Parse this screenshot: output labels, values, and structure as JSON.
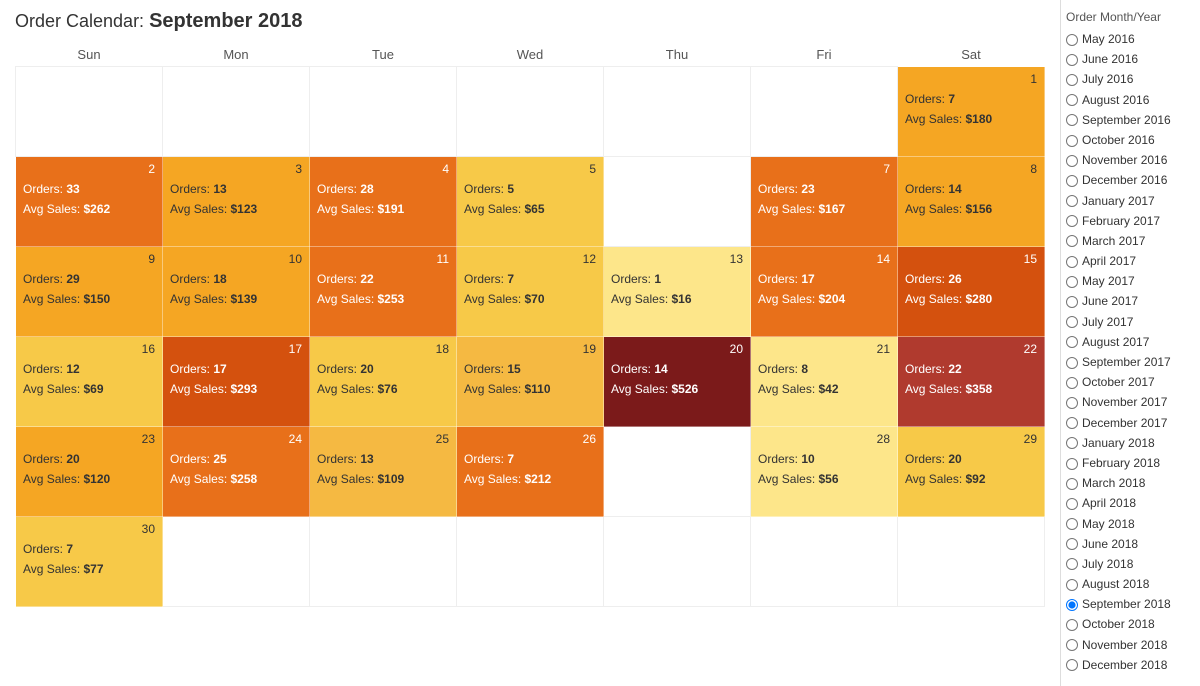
{
  "header": {
    "title_prefix": "Order Calendar:",
    "title_bold": "September 2018"
  },
  "calendar": {
    "headers": [
      "Sun",
      "Mon",
      "Tue",
      "Wed",
      "Thu",
      "Fri",
      "Sat"
    ],
    "rows": [
      [
        {
          "day": "",
          "empty": true
        },
        {
          "day": "",
          "empty": true
        },
        {
          "day": "",
          "empty": true
        },
        {
          "day": "",
          "empty": true
        },
        {
          "day": "",
          "empty": true
        },
        {
          "day": "",
          "empty": true
        },
        {
          "day": "1",
          "orders": 7,
          "avg_sales": 180,
          "color": "light-orange"
        }
      ],
      [
        {
          "day": "2",
          "orders": 33,
          "avg_sales": 262,
          "color": "orange"
        },
        {
          "day": "3",
          "orders": 13,
          "avg_sales": 123,
          "color": "light-orange"
        },
        {
          "day": "4",
          "orders": 28,
          "avg_sales": 191,
          "color": "orange"
        },
        {
          "day": "5",
          "orders": 5,
          "avg_sales": 65,
          "color": "yellow"
        },
        {
          "day": "",
          "empty": true
        },
        {
          "day": "7",
          "orders": 23,
          "avg_sales": 167,
          "color": "orange"
        },
        {
          "day": "8",
          "orders": 14,
          "avg_sales": 156,
          "color": "light-orange"
        }
      ],
      [
        {
          "day": "9",
          "orders": 29,
          "avg_sales": 150,
          "color": "light-orange"
        },
        {
          "day": "10",
          "orders": 18,
          "avg_sales": 139,
          "color": "light-orange"
        },
        {
          "day": "11",
          "orders": 22,
          "avg_sales": 253,
          "color": "orange"
        },
        {
          "day": "12",
          "orders": 7,
          "avg_sales": 70,
          "color": "yellow"
        },
        {
          "day": "13",
          "orders": 1,
          "avg_sales": 16,
          "color": "very-light"
        },
        {
          "day": "14",
          "orders": 17,
          "avg_sales": 204,
          "color": "orange"
        },
        {
          "day": "15",
          "orders": 26,
          "avg_sales": 280,
          "color": "dark-orange"
        }
      ],
      [
        {
          "day": "16",
          "orders": 12,
          "avg_sales": 69,
          "color": "yellow"
        },
        {
          "day": "17",
          "orders": 17,
          "avg_sales": 293,
          "color": "dark-orange"
        },
        {
          "day": "18",
          "orders": 20,
          "avg_sales": 76,
          "color": "yellow"
        },
        {
          "day": "19",
          "orders": 15,
          "avg_sales": 110,
          "color": "pale-orange"
        },
        {
          "day": "20",
          "orders": 14,
          "avg_sales": 526,
          "color": "dark-red"
        },
        {
          "day": "21",
          "orders": 8,
          "avg_sales": 42,
          "color": "very-light"
        },
        {
          "day": "22",
          "orders": 22,
          "avg_sales": 358,
          "color": "red"
        }
      ],
      [
        {
          "day": "23",
          "orders": 20,
          "avg_sales": 120,
          "color": "light-orange"
        },
        {
          "day": "24",
          "orders": 25,
          "avg_sales": 258,
          "color": "orange"
        },
        {
          "day": "25",
          "orders": 13,
          "avg_sales": 109,
          "color": "pale-orange"
        },
        {
          "day": "26",
          "orders": 7,
          "avg_sales": 212,
          "color": "orange"
        },
        {
          "day": "",
          "empty": true
        },
        {
          "day": "28",
          "orders": 10,
          "avg_sales": 56,
          "color": "very-light"
        },
        {
          "day": "29",
          "orders": 20,
          "avg_sales": 92,
          "color": "yellow"
        }
      ],
      [
        {
          "day": "30",
          "orders": 7,
          "avg_sales": 77,
          "color": "yellow"
        },
        {
          "day": "",
          "empty": true
        },
        {
          "day": "",
          "empty": true
        },
        {
          "day": "",
          "empty": true
        },
        {
          "day": "",
          "empty": true
        },
        {
          "day": "",
          "empty": true
        },
        {
          "day": "",
          "empty": true
        }
      ]
    ]
  },
  "sidebar": {
    "title": "Order Month/Year",
    "options": [
      {
        "label": "May 2016",
        "value": "may2016",
        "selected": false
      },
      {
        "label": "June 2016",
        "value": "jun2016",
        "selected": false
      },
      {
        "label": "July 2016",
        "value": "jul2016",
        "selected": false
      },
      {
        "label": "August 2016",
        "value": "aug2016",
        "selected": false
      },
      {
        "label": "September 2016",
        "value": "sep2016",
        "selected": false
      },
      {
        "label": "October 2016",
        "value": "oct2016",
        "selected": false
      },
      {
        "label": "November 2016",
        "value": "nov2016",
        "selected": false
      },
      {
        "label": "December 2016",
        "value": "dec2016",
        "selected": false
      },
      {
        "label": "January 2017",
        "value": "jan2017",
        "selected": false
      },
      {
        "label": "February 2017",
        "value": "feb2017",
        "selected": false
      },
      {
        "label": "March 2017",
        "value": "mar2017",
        "selected": false
      },
      {
        "label": "April 2017",
        "value": "apr2017",
        "selected": false
      },
      {
        "label": "May 2017",
        "value": "may2017",
        "selected": false
      },
      {
        "label": "June 2017",
        "value": "jun2017",
        "selected": false
      },
      {
        "label": "July 2017",
        "value": "jul2017",
        "selected": false
      },
      {
        "label": "August 2017",
        "value": "aug2017",
        "selected": false
      },
      {
        "label": "September 2017",
        "value": "sep2017",
        "selected": false
      },
      {
        "label": "October 2017",
        "value": "oct2017",
        "selected": false
      },
      {
        "label": "November 2017",
        "value": "nov2017",
        "selected": false
      },
      {
        "label": "December 2017",
        "value": "dec2017",
        "selected": false
      },
      {
        "label": "January 2018",
        "value": "jan2018",
        "selected": false
      },
      {
        "label": "February 2018",
        "value": "feb2018",
        "selected": false
      },
      {
        "label": "March 2018",
        "value": "mar2018",
        "selected": false
      },
      {
        "label": "April 2018",
        "value": "apr2018",
        "selected": false
      },
      {
        "label": "May 2018",
        "value": "may2018",
        "selected": false
      },
      {
        "label": "June 2018",
        "value": "jun2018",
        "selected": false
      },
      {
        "label": "July 2018",
        "value": "jul2018",
        "selected": false
      },
      {
        "label": "August 2018",
        "value": "aug2018",
        "selected": false
      },
      {
        "label": "September 2018",
        "value": "sep2018",
        "selected": true
      },
      {
        "label": "October 2018",
        "value": "oct2018",
        "selected": false
      },
      {
        "label": "November 2018",
        "value": "nov2018",
        "selected": false
      },
      {
        "label": "December 2018",
        "value": "dec2018",
        "selected": false
      }
    ]
  },
  "labels": {
    "orders": "Orders:",
    "avg_sales": "Avg Sales:"
  },
  "colors": {
    "very-light": "#fde68a",
    "yellow": "#f7c948",
    "pale-orange": "#f5b942",
    "light-orange": "#f5a623",
    "orange": "#e8701a",
    "dark-orange": "#d4510e",
    "red": "#b03a2e",
    "dark-red": "#7b1a1a"
  }
}
